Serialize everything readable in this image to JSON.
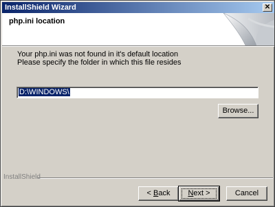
{
  "window": {
    "title": "InstallShield Wizard"
  },
  "header": {
    "title": "php.ini location"
  },
  "message": {
    "line1": "Your php.ini was not found in it's default location",
    "line2": "Please specify the folder in which this file resides"
  },
  "folder_input": {
    "value": "D:\\WINDOWS\\"
  },
  "buttons": {
    "browse": "Browse...",
    "back_accel": "B",
    "back_rest": "ack",
    "back_prefix": "< ",
    "next_accel": "N",
    "next_rest": "ext >",
    "cancel": "Cancel"
  },
  "brand": "InstallShield",
  "colors": {
    "title_start": "#0a246a",
    "title_end": "#a6caf0",
    "dialog_bg": "#d4d0c8"
  }
}
